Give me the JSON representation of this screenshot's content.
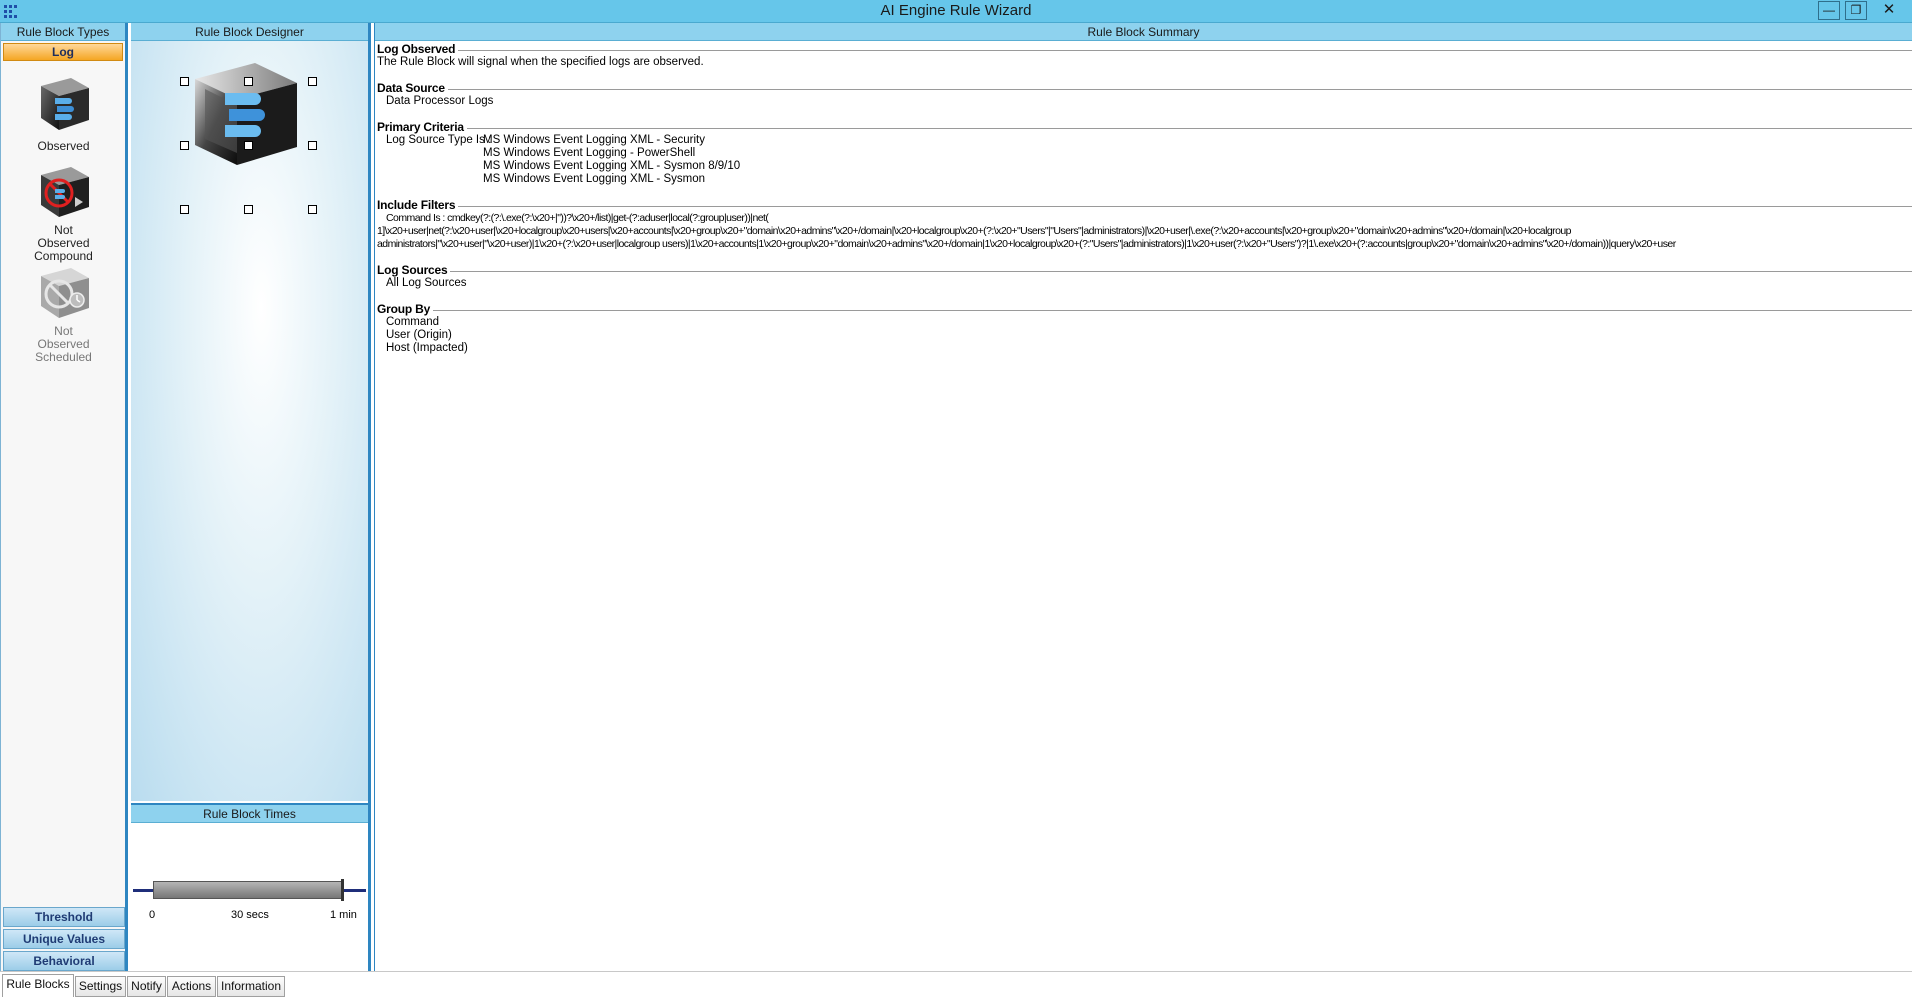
{
  "window": {
    "title": "AI Engine Rule Wizard",
    "min_glyph": "—",
    "max_glyph": "❐",
    "close_glyph": "✕"
  },
  "left_panel": {
    "header": "Rule Block Types",
    "active_tab": "Log",
    "block_types": [
      {
        "label": "Observed",
        "icon": "observed-cube-icon"
      },
      {
        "label": "Not Observed Compound",
        "icon": "not-observed-compound-icon"
      },
      {
        "label": "Not Observed Scheduled",
        "icon": "not-observed-scheduled-icon"
      }
    ],
    "bottom_tabs": [
      "Threshold",
      "Unique Values",
      "Behavioral"
    ]
  },
  "designer": {
    "header": "Rule Block Designer"
  },
  "times": {
    "header": "Rule Block Times",
    "ticks": [
      "0",
      "30 secs",
      "1 min"
    ]
  },
  "summary": {
    "header": "Rule Block Summary",
    "log_observed": {
      "title": "Log Observed",
      "text": "The Rule Block will signal when the specified logs are observed."
    },
    "data_source": {
      "title": "Data Source",
      "text": "Data Processor Logs"
    },
    "primary_criteria": {
      "title": "Primary Criteria",
      "label": "Log Source Type Is :",
      "values": [
        "MS Windows Event Logging XML - Security",
        "MS Windows Event Logging - PowerShell",
        "MS Windows Event Logging XML - Sysmon 8/9/10",
        "MS Windows Event Logging XML - Sysmon"
      ]
    },
    "include_filters": {
      "title": "Include Filters",
      "line1": "Command Is : cmdkey(?:(?:\\.exe(?:\\x20+|\"))?\\x20+/list)|get-(?:aduser|local(?:group|user))|net(",
      "line2": "1]\\x20+user|net(?:\\x20+user|\\x20+localgroup\\x20+users|\\x20+accounts|\\x20+group\\x20+\"domain\\x20+admins\"\\x20+/domain|\\x20+localgroup\\x20+(?:\\x20+\"Users\"|\"Users\"|administrators)|\\x20+user|\\.exe(?:\\x20+accounts|\\x20+group\\x20+\"domain\\x20+admins\"\\x20+/domain|\\x20+localgroup",
      "line3": "administrators|\"\\x20+user|\"\\x20+user)|1\\x20+(?:\\x20+user|localgroup users)|1\\x20+accounts|1\\x20+group\\x20+\"domain\\x20+admins\"\\x20+/domain|1\\x20+localgroup\\x20+(?:\"Users\"|administrators)|1\\x20+user(?:\\x20+\"Users\")?|1\\.exe\\x20+(?:accounts|group\\x20+\"domain\\x20+admins\"\\x20+/domain))|query\\x20+user"
    },
    "log_sources": {
      "title": "Log Sources",
      "text": "All Log Sources"
    },
    "group_by": {
      "title": "Group By",
      "items": [
        "Command",
        "User (Origin)",
        "Host (Impacted)"
      ]
    }
  },
  "bottom_tabs": [
    "Rule Blocks",
    "Settings",
    "Notify",
    "Actions",
    "Information"
  ],
  "colors": {
    "title_bar": "#66c6ea",
    "accent_border": "#2e86c1",
    "active_tab": "#f5a623"
  }
}
